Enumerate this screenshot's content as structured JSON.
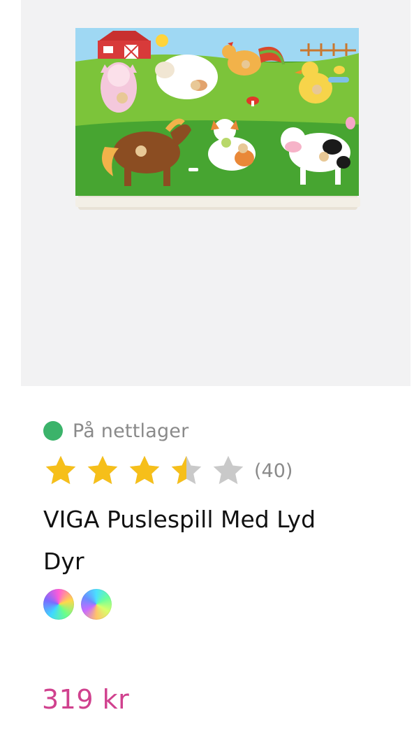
{
  "product": {
    "image_alt": "VIGA wooden peg puzzle with farm animals",
    "availability": {
      "label": "På nettlager",
      "status_color": "#3bb36a"
    },
    "rating": {
      "value": 3.5,
      "max": 5,
      "review_count_label": "(40)",
      "star_filled_color": "#f6bf1a",
      "star_empty_color": "#c9c9c9"
    },
    "title_line1": "VIGA Puslespill Med Lyd",
    "title_line2": "Dyr",
    "color_swatches": [
      {
        "name": "rainbow-swatch-1"
      },
      {
        "name": "rainbow-swatch-2"
      }
    ],
    "price": "319 kr",
    "price_color": "#d0418e"
  }
}
